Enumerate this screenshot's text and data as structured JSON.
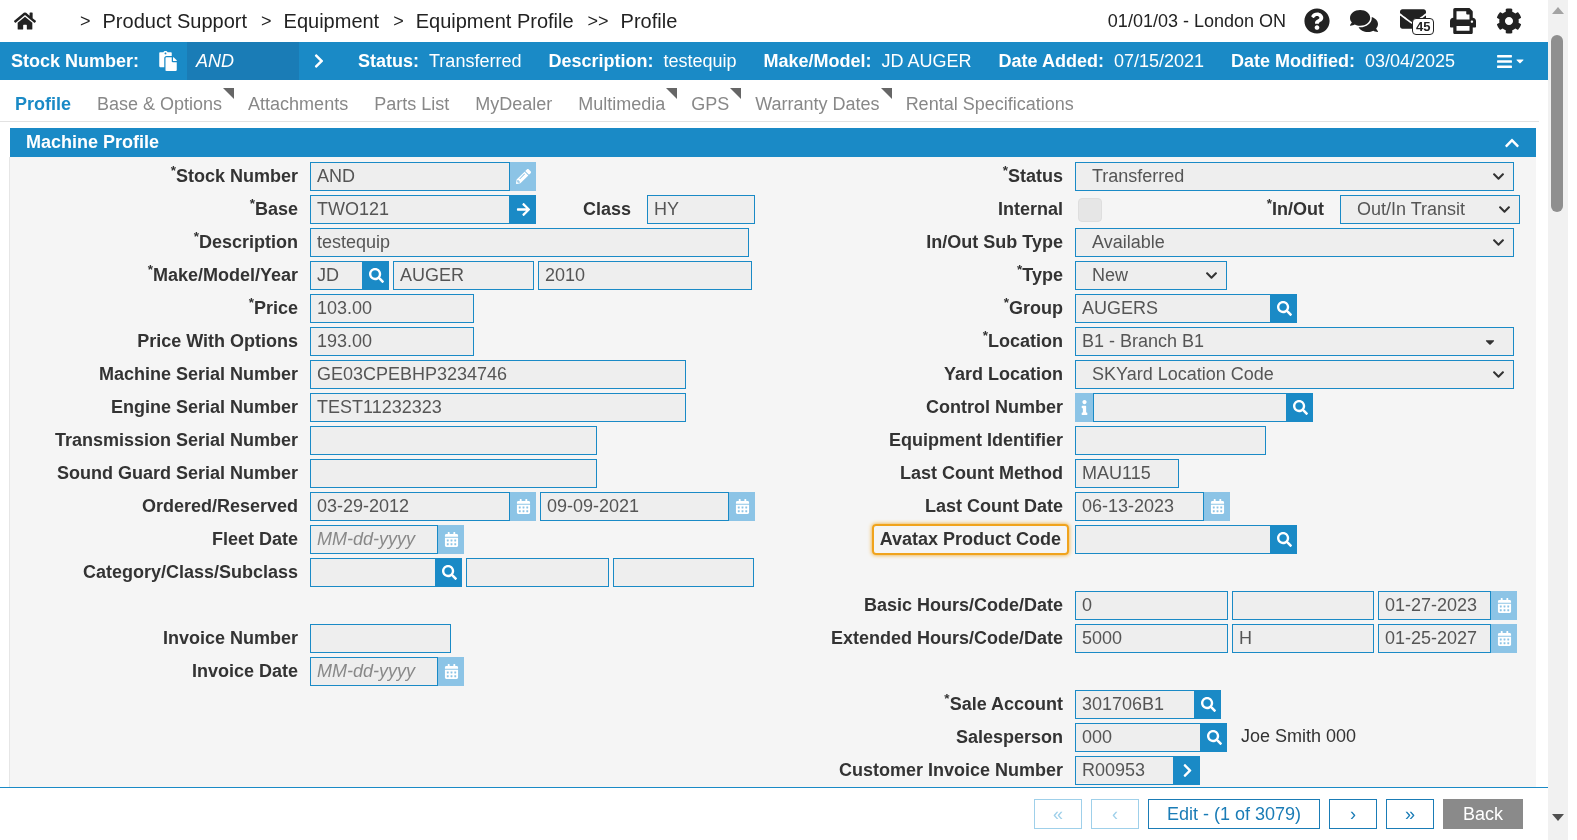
{
  "top_bar": {
    "breadcrumbs": [
      {
        "separator": ">",
        "label": "Product Support"
      },
      {
        "separator": ">",
        "label": "Equipment"
      },
      {
        "separator": ">",
        "label": "Equipment Profile"
      },
      {
        "separator": ">>",
        "label": "Profile"
      }
    ],
    "location": "01/01/03 - London ON",
    "mail_count": "45"
  },
  "summary_bar": [
    {
      "kind": "lookup",
      "label": "Stock Number:",
      "value": "AND"
    },
    {
      "kind": "info",
      "label": "Status:",
      "value": "Transferred"
    },
    {
      "kind": "info",
      "label": "Description:",
      "value": "testequip"
    },
    {
      "kind": "info",
      "label": "Make/Model:",
      "value": "JD AUGER"
    },
    {
      "kind": "info",
      "label": "Date Added:",
      "value": "07/15/2021"
    },
    {
      "kind": "info",
      "label": "Date Modified:",
      "value": "03/04/2025"
    }
  ],
  "tabs": [
    {
      "label": "Profile",
      "selected": true,
      "flagged": false
    },
    {
      "label": "Base & Options",
      "selected": false,
      "flagged": true
    },
    {
      "label": "Attachments",
      "selected": false,
      "flagged": false
    },
    {
      "label": "Parts List",
      "selected": false,
      "flagged": false
    },
    {
      "label": "MyDealer",
      "selected": false,
      "flagged": false
    },
    {
      "label": "Multimedia",
      "selected": false,
      "flagged": true
    },
    {
      "label": "GPS",
      "selected": false,
      "flagged": true
    },
    {
      "label": "Warranty Dates",
      "selected": false,
      "flagged": true
    },
    {
      "label": "Rental Specifications",
      "selected": false,
      "flagged": false
    }
  ],
  "section": {
    "title": "Machine Profile",
    "expanded": true
  },
  "left_column": [
    [
      {
        "label": "$^{*}$Stock Number",
        "items": [
          {
            "kind": "text",
            "value": "AND",
            "addon": {
              "kind": "edit"
            }
          }
        ]
      },
      {
        "label": "$^{*}$Base",
        "items": [
          {
            "kind": "text",
            "value": "TWO121",
            "addon": {
              "kind": "arrow"
            }
          },
          {
            "kind": "label",
            "text": "Class"
          },
          {
            "kind": "text",
            "value": "HY"
          }
        ]
      },
      {
        "label": "$^{*}$Description",
        "items": [
          {
            "kind": "text",
            "value": "testequip"
          }
        ]
      },
      {
        "label": "$^{*}$Make/Model/Year",
        "items": [
          {
            "kind": "text",
            "value": "JD",
            "addon": {
              "kind": "search"
            }
          },
          {
            "kind": "text",
            "value": "AUGER"
          },
          {
            "kind": "text",
            "value": "2010"
          }
        ]
      },
      {
        "label": "$^{*}$Price",
        "items": [
          {
            "kind": "text",
            "value": "103.00"
          }
        ]
      },
      {
        "label": "Price With Options",
        "items": [
          {
            "kind": "text",
            "value": "193.00"
          }
        ]
      },
      {
        "label": "Machine Serial Number",
        "items": [
          {
            "kind": "text",
            "value": "GE03CPEBHP3234746"
          }
        ]
      },
      {
        "label": "Engine Serial Number",
        "items": [
          {
            "kind": "text",
            "value": "TEST11232323"
          }
        ]
      },
      {
        "label": "Transmission Serial Number",
        "items": [
          {
            "kind": "text"
          }
        ]
      },
      {
        "label": "Sound Guard Serial Number",
        "items": [
          {
            "kind": "text"
          }
        ]
      },
      {
        "label": "Ordered/Reserved",
        "items": [
          {
            "kind": "text",
            "value": "03-29-2012",
            "addon": {
              "kind": "calendar"
            }
          },
          {
            "kind": "text",
            "value": "09-09-2021",
            "addon": {
              "kind": "calendar"
            }
          }
        ]
      },
      {
        "label": "Fleet Date",
        "items": [
          {
            "kind": "text",
            "placeholder": "MM-dd-yyyy",
            "addon": {
              "kind": "calendar"
            }
          }
        ]
      },
      {
        "label": "Category/Class/Subclass",
        "items": [
          {
            "kind": "text",
            "addon": {
              "kind": "search"
            }
          },
          {
            "kind": "text"
          },
          {
            "kind": "text"
          }
        ]
      }
    ],
    [
      {
        "label": "Invoice Number",
        "items": [
          {
            "kind": "text"
          }
        ]
      },
      {
        "label": "Invoice Date",
        "items": [
          {
            "kind": "text",
            "placeholder": "MM-dd-yyyy",
            "addon": {
              "kind": "calendar"
            }
          }
        ]
      }
    ]
  ],
  "right_column": [
    [
      {
        "label": "$^{*}$Status",
        "items": [
          {
            "kind": "select",
            "value": "Transferred"
          }
        ]
      },
      {
        "label": "Internal",
        "items": [
          {
            "kind": "checkbox",
            "checked": false
          },
          {
            "kind": "label",
            "text": "$^{*}$In/Out"
          },
          {
            "kind": "select",
            "value": "Out/In Transit"
          }
        ]
      },
      {
        "label": "In/Out Sub Type",
        "items": [
          {
            "kind": "select",
            "value": "Available"
          }
        ]
      },
      {
        "label": "$^{*}$Type",
        "items": [
          {
            "kind": "select",
            "value": "New"
          }
        ]
      },
      {
        "label": "$^{*}$Group",
        "items": [
          {
            "kind": "text",
            "value": "AUGERS",
            "addon": {
              "kind": "search"
            }
          }
        ]
      },
      {
        "label": "$^{*}$Location",
        "items": [
          {
            "kind": "picklist",
            "value": "B1 - Branch B1"
          }
        ]
      },
      {
        "label": "Yard Location",
        "items": [
          {
            "kind": "select",
            "value": "SKYard Location Code"
          }
        ]
      },
      {
        "label": "Control Number",
        "items": [
          {
            "kind": "text",
            "addon": {
              "kind": "search"
            },
            "prefix": {
              "kind": "info"
            }
          }
        ]
      },
      {
        "label": "Equipment Identifier",
        "items": [
          {
            "kind": "text"
          }
        ]
      },
      {
        "label": "Last Count Method",
        "items": [
          {
            "kind": "text",
            "value": "MAU115"
          }
        ]
      },
      {
        "label": "Last Count Date",
        "items": [
          {
            "kind": "text",
            "value": "06-13-2023",
            "addon": {
              "kind": "calendar"
            }
          }
        ]
      },
      {
        "label": "Avatax Product Code",
        "highlighted": true,
        "items": [
          {
            "kind": "text",
            "addon": {
              "kind": "search"
            }
          }
        ]
      }
    ],
    [
      {
        "label": "Basic Hours/Code/Date",
        "items": [
          {
            "kind": "text",
            "value": "0"
          },
          {
            "kind": "text"
          },
          {
            "kind": "text",
            "value": "01-27-2023",
            "addon": {
              "kind": "calendar"
            }
          }
        ]
      },
      {
        "label": "Extended Hours/Code/Date",
        "items": [
          {
            "kind": "text",
            "value": "5000"
          },
          {
            "kind": "text",
            "value": "H"
          },
          {
            "kind": "text",
            "value": "01-25-2027",
            "addon": {
              "kind": "calendar"
            }
          }
        ]
      }
    ],
    [
      {
        "label": "$^{*}$Sale Account",
        "items": [
          {
            "kind": "text",
            "value": "301706B1",
            "addon": {
              "kind": "search"
            }
          }
        ]
      },
      {
        "label": "Salesperson",
        "items": [
          {
            "kind": "text",
            "value": "000",
            "addon": {
              "kind": "search"
            }
          },
          {
            "kind": "note",
            "text": "Joe Smith 000"
          }
        ]
      },
      {
        "label": "Customer Invoice Number",
        "items": [
          {
            "kind": "text",
            "value": "R00953",
            "addon": {
              "kind": "next"
            }
          }
        ]
      }
    ]
  ],
  "footer_buttons": [
    {
      "kind": "nav",
      "label": "«",
      "disabled": true
    },
    {
      "kind": "nav",
      "label": "‹",
      "disabled": true
    },
    {
      "kind": "nav",
      "label": "Edit - (1 of 3079)",
      "disabled": false
    },
    {
      "kind": "nav",
      "label": "›",
      "disabled": false
    },
    {
      "kind": "nav",
      "label": "»",
      "disabled": false
    },
    {
      "kind": "back",
      "label": "Back",
      "disabled": false
    }
  ]
}
